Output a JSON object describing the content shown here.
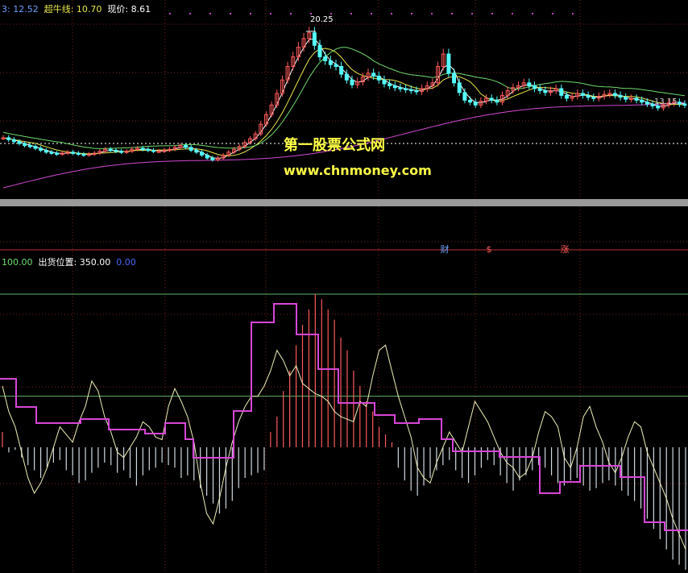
{
  "colors": {
    "background": "#000000",
    "grid": "#7a1f1f",
    "candle_up": "#ff5a5a",
    "candle_down": "#54ffff",
    "ma_white": "#ffffff",
    "ma_yellow": "#e8e84a",
    "ma_green": "#6fdc6f",
    "ma_magenta": "#d24ad2",
    "histogram_red": "#ff5a5a",
    "histogram_white": "#cfd8e0",
    "osc_line": "#efefb8",
    "position_line": "#d846d8",
    "level_line": "#66b866",
    "watermark": "#ffff44"
  },
  "main_panel": {
    "header": {
      "item1": "3: 12.52",
      "item2": "超牛线: 10.70",
      "item3": "现价: 8.61"
    },
    "peak_label": "20.25",
    "right_label": "13.15",
    "event_markers": [
      "财",
      "$",
      "涨"
    ],
    "watermark": {
      "line1": "第一股票公式网",
      "line2": "www.chnmoney.com"
    }
  },
  "indicator_panel": {
    "header": {
      "item1": "100.00",
      "item2": "出货位置: 350.00",
      "item3": "0.00"
    }
  },
  "chart_data": [
    {
      "type": "candlestick",
      "title": "",
      "price_min": 3.0,
      "price_max": 22.0,
      "peak_price": 20.25,
      "dashed_level": 8.61,
      "closes": [
        9.2,
        9.0,
        8.8,
        8.6,
        8.4,
        8.3,
        8.1,
        7.9,
        7.7,
        7.6,
        7.5,
        7.6,
        7.7,
        7.6,
        7.5,
        7.4,
        7.5,
        7.6,
        7.8,
        8.0,
        7.9,
        7.8,
        7.7,
        7.8,
        8.0,
        8.1,
        8.0,
        7.9,
        7.8,
        7.8,
        7.9,
        8.0,
        8.2,
        8.4,
        8.2,
        7.9,
        7.7,
        7.4,
        7.1,
        6.9,
        7.1,
        7.4,
        7.7,
        8.0,
        8.3,
        8.7,
        9.1,
        9.6,
        10.6,
        11.6,
        12.6,
        13.8,
        15.2,
        16.6,
        17.6,
        18.6,
        19.5,
        20.1,
        18.8,
        17.6,
        17.2,
        16.8,
        16.6,
        15.8,
        15.2,
        14.7,
        15.0,
        15.5,
        15.9,
        15.6,
        15.2,
        14.8,
        14.6,
        14.4,
        14.3,
        14.2,
        14.1,
        14.0,
        14.3,
        14.6,
        14.9,
        16.6,
        17.9,
        15.9,
        14.9,
        13.9,
        13.1,
        12.9,
        12.6,
        13.0,
        13.3,
        13.1,
        12.9,
        13.6,
        14.1,
        14.4,
        14.6,
        14.9,
        14.6,
        14.3,
        14.1,
        13.9,
        14.1,
        14.3,
        13.6,
        13.3,
        13.5,
        13.8,
        13.6,
        13.4,
        13.3,
        13.5,
        13.7,
        13.8,
        13.6,
        13.4,
        13.2,
        13.3,
        13.1,
        12.9,
        12.7,
        12.5,
        12.3,
        12.6,
        12.8,
        12.9,
        12.7,
        12.6
      ],
      "ma_series": [
        "white",
        "yellow",
        "green",
        "magenta"
      ]
    },
    {
      "type": "oscillator",
      "title": "",
      "y_min": 0,
      "y_max": 350,
      "green_level": 100,
      "histogram": [
        30,
        -10,
        -5,
        -20,
        -35,
        -45,
        -60,
        -40,
        -30,
        -25,
        -45,
        -55,
        -70,
        -65,
        -50,
        -40,
        -30,
        -35,
        -50,
        -45,
        -60,
        -75,
        -55,
        -45,
        -40,
        -30,
        -35,
        -40,
        -60,
        -55,
        -65,
        -80,
        -95,
        -110,
        -130,
        -120,
        -105,
        -80,
        -60,
        -55,
        -50,
        -45,
        30,
        60,
        110,
        150,
        200,
        240,
        270,
        300,
        290,
        270,
        250,
        215,
        190,
        150,
        120,
        90,
        70,
        40,
        25,
        10,
        -40,
        -65,
        -85,
        -95,
        -75,
        -60,
        -45,
        -35,
        -25,
        -45,
        -60,
        -70,
        -55,
        -40,
        -25,
        -35,
        -55,
        -70,
        -85,
        -65,
        -55,
        -45,
        -35,
        -40,
        -55,
        -70,
        -75,
        -65,
        -60,
        -75,
        -85,
        -80,
        -70,
        -65,
        -75,
        -85,
        -95,
        -105,
        -120,
        -140,
        -160,
        -180,
        -200,
        -220,
        -230,
        -240
      ],
      "oscillator": [
        120,
        70,
        40,
        -10,
        -60,
        -90,
        -70,
        -40,
        0,
        40,
        25,
        10,
        50,
        80,
        130,
        110,
        60,
        30,
        -10,
        -20,
        0,
        20,
        50,
        40,
        20,
        15,
        80,
        115,
        90,
        60,
        10,
        -70,
        -130,
        -150,
        -100,
        -40,
        10,
        50,
        80,
        100,
        100,
        120,
        150,
        190,
        170,
        140,
        160,
        125,
        115,
        105,
        100,
        90,
        70,
        60,
        55,
        50,
        90,
        80,
        140,
        190,
        200,
        150,
        100,
        60,
        20,
        -40,
        -60,
        -70,
        -30,
        0,
        30,
        10,
        -10,
        40,
        90,
        70,
        50,
        20,
        -10,
        -30,
        -40,
        -60,
        -50,
        -20,
        30,
        70,
        60,
        40,
        -20,
        -40,
        0,
        60,
        80,
        40,
        10,
        -30,
        -50,
        -20,
        20,
        50,
        40,
        -10,
        -40,
        -70,
        -100,
        -140,
        -170,
        -200
      ]
    }
  ]
}
